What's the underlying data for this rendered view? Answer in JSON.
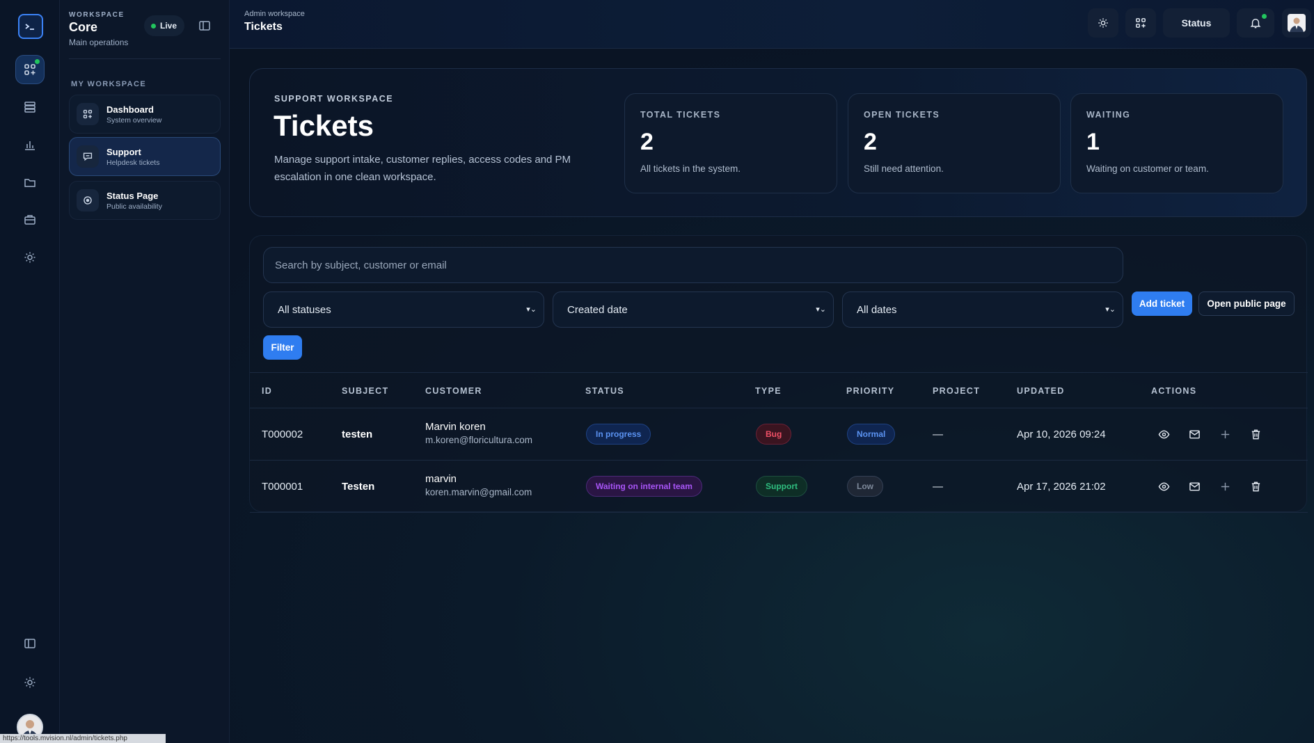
{
  "colors": {
    "accent": "#2f7df0",
    "live": "#22c55e",
    "bg": "#0a1424"
  },
  "rail": {
    "icons": [
      "terminal-logo-icon",
      "apps-icon",
      "server-icon",
      "bar-chart-icon",
      "folder-icon",
      "briefcase-icon",
      "sun-icon",
      "sidebar-toggle-icon",
      "sun-icon",
      "avatar"
    ]
  },
  "sidebar": {
    "eyebrow": "WORKSPACE",
    "title": "Core",
    "subtitle": "Main operations",
    "live_label": "Live",
    "section": "MY WORKSPACE",
    "items": [
      {
        "label": "Dashboard",
        "sub": "System overview",
        "icon": "apps-icon"
      },
      {
        "label": "Support",
        "sub": "Helpdesk tickets",
        "icon": "chat-icon"
      },
      {
        "label": "Status Page",
        "sub": "Public availability",
        "icon": "target-icon"
      }
    ]
  },
  "topbar": {
    "breadcrumb": "Admin workspace",
    "title": "Tickets",
    "status_label": "Status"
  },
  "hero": {
    "eyebrow": "SUPPORT WORKSPACE",
    "title": "Tickets",
    "description": "Manage support intake, customer replies, access codes and PM escalation in one clean workspace.",
    "stats": [
      {
        "label": "TOTAL TICKETS",
        "value": "2",
        "desc": "All tickets in the system."
      },
      {
        "label": "OPEN TICKETS",
        "value": "2",
        "desc": "Still need attention."
      },
      {
        "label": "WAITING",
        "value": "1",
        "desc": "Waiting on customer or team."
      }
    ]
  },
  "filters": {
    "search_placeholder": "Search by subject, customer or email",
    "status_select": "All statuses",
    "sort_select": "Created date",
    "date_select": "All dates",
    "add_ticket": "Add ticket",
    "open_public": "Open public page",
    "filter": "Filter"
  },
  "table": {
    "headers": [
      "ID",
      "SUBJECT",
      "CUSTOMER",
      "STATUS",
      "TYPE",
      "PRIORITY",
      "PROJECT",
      "UPDATED",
      "ACTIONS"
    ],
    "rows": [
      {
        "id": "T000002",
        "subject": "testen",
        "customer": "Marvin koren",
        "email": "m.koren@floricultura.com",
        "status": "In progress",
        "type": "Bug",
        "priority": "Normal",
        "project": "—",
        "updated": "Apr 10, 2026 09:24"
      },
      {
        "id": "T000001",
        "subject": "Testen",
        "customer": "marvin",
        "email": "koren.marvin@gmail.com",
        "status": "Waiting on internal team",
        "type": "Support",
        "priority": "Low",
        "project": "—",
        "updated": "Apr 17, 2026 21:02"
      }
    ]
  },
  "statusbar": {
    "url": "https://tools.mvision.nl/admin/tickets.php"
  }
}
